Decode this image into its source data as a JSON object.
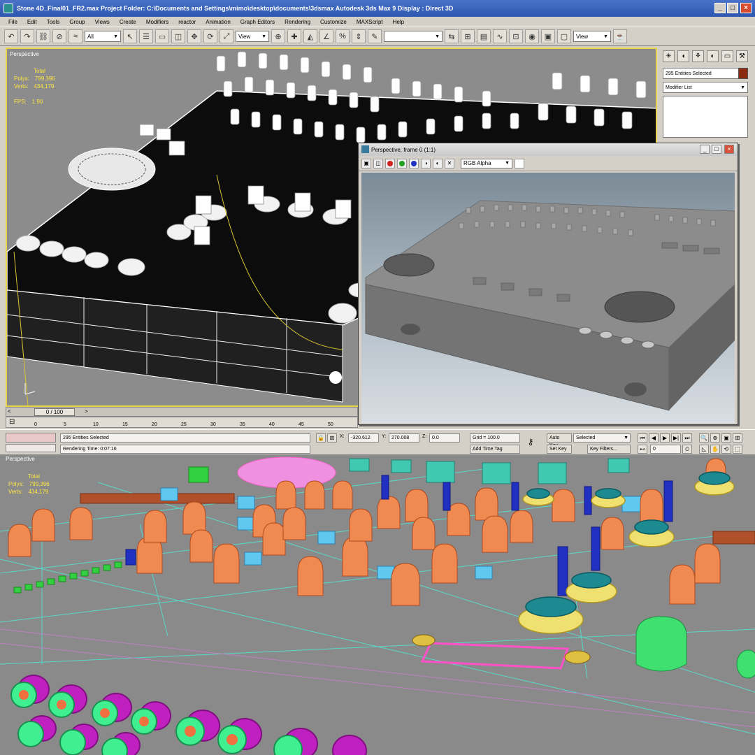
{
  "window": {
    "title": "Stone 4D_Final01_FR2.max    Project Folder: C:\\Documents and Settings\\mimo\\desktop\\documents\\3dsmax    Autodesk 3ds Max 9    Display : Direct 3D"
  },
  "menu": [
    "File",
    "Edit",
    "Tools",
    "Group",
    "Views",
    "Create",
    "Modifiers",
    "reactor",
    "Animation",
    "Graph Editors",
    "Rendering",
    "Customize",
    "MAXScript",
    "Help"
  ],
  "toolbar": {
    "selection_filter": "All",
    "ref_coord": "View",
    "named_selection": "",
    "render_type": "View"
  },
  "viewport_top": {
    "label": "Perspective",
    "stats_header": "Total",
    "polys_label": "Polys:",
    "polys_value": "799,396",
    "verts_label": "Verts:",
    "verts_value": "434,179",
    "fps_label": "FPS:",
    "fps_value": "1.90"
  },
  "command_panel": {
    "selection_field": "295 Entities Selected",
    "modifier_list": "Modifier List",
    "accent_color": "#8a2a10"
  },
  "render_window": {
    "title": "Perspective, frame 0 (1:1)",
    "channel": "RGB Alpha"
  },
  "time_slider": {
    "frame_display": "0 / 100"
  },
  "trackbar": {
    "ticks": [
      "0",
      "5",
      "10",
      "15",
      "20",
      "25",
      "30",
      "35",
      "40",
      "45",
      "50"
    ]
  },
  "status": {
    "selection": "295 Entities Selected",
    "prompt": "Rendering Time: 0:07:16",
    "x_label": "X:",
    "x_value": "-320.612",
    "y_label": "Y:",
    "y_value": "270.008",
    "z_label": "Z:",
    "z_value": "0.0",
    "grid": "Grid = 100.0",
    "add_time_tag": "Add Time Tag",
    "auto_key": "Auto Key",
    "set_key": "Set Key",
    "key_mode": "Selected",
    "key_filters": "Key Filters...",
    "current_frame": "0"
  },
  "viewport_bottom": {
    "label": "Perspective",
    "stats_header": "Total",
    "polys_label": "Polys:",
    "polys_value": "799,396",
    "verts_label": "Verts:",
    "verts_value": "434,179"
  }
}
